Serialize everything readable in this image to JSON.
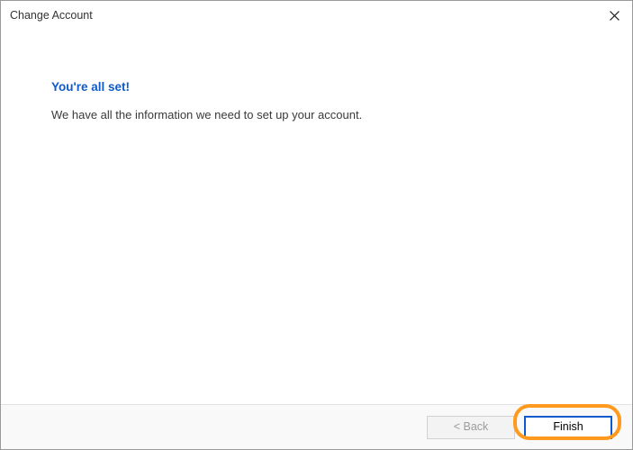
{
  "dialog": {
    "title": "Change Account",
    "close_icon": "close-icon"
  },
  "content": {
    "heading": "You're all set!",
    "description": "We have all the information we need to set up your account."
  },
  "footer": {
    "back_label": "< Back",
    "finish_label": "Finish"
  }
}
